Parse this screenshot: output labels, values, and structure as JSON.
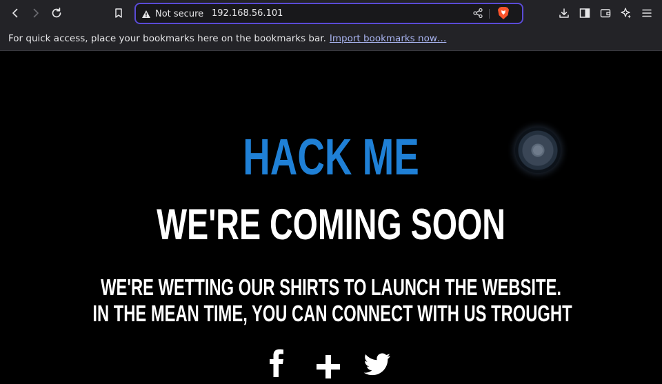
{
  "browser": {
    "url_security": "Not secure",
    "url": "192.168.56.101",
    "colors": {
      "toolbar_bg": "#232327",
      "urlbar_border": "#5a4bd6",
      "brave": "#fb542b"
    },
    "icons": [
      "back-icon",
      "forward-icon",
      "reload-icon",
      "bookmark-icon",
      "warning-icon",
      "share-icon",
      "brave-shield-icon",
      "download-icon",
      "sidebar-icon",
      "wallet-icon",
      "leo-ai-icon",
      "menu-icon"
    ]
  },
  "bookmarks_bar": {
    "message": "For quick access, place your bookmarks here on the bookmarks bar.",
    "import_link": "Import bookmarks now…"
  },
  "page": {
    "title": "HACK ME",
    "subtitle": "WE'RE COMING SOON",
    "text_line_1": "WE'RE WETTING OUR SHIRTS TO LAUNCH THE WEBSITE.",
    "text_line_2": "IN THE MEAN TIME, YOU CAN CONNECT WITH US TROUGHT",
    "socials": [
      "facebook-icon",
      "google-plus-icon",
      "twitter-icon"
    ],
    "colors": {
      "title": "#1f80d6",
      "text": "#ffffff",
      "background": "#000000"
    }
  }
}
